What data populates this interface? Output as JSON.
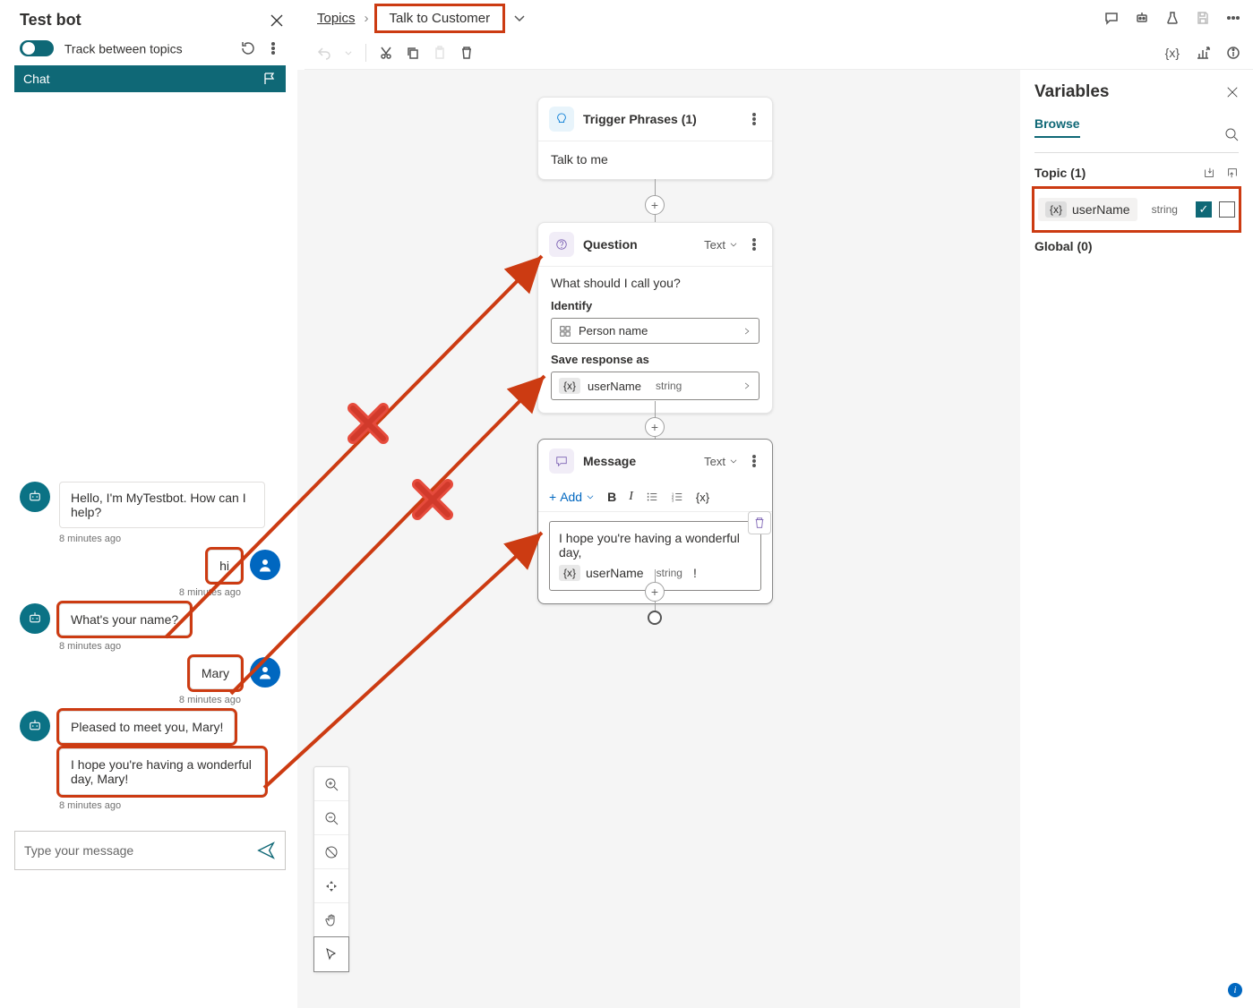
{
  "testPanel": {
    "title": "Test bot",
    "trackLabel": "Track between topics",
    "chatTab": "Chat",
    "inputPlaceholder": "Type your message",
    "messages": [
      {
        "role": "bot",
        "text": "Hello, I'm MyTestbot. How can I help?",
        "time": "8 minutes ago",
        "hl": false
      },
      {
        "role": "user",
        "text": "hi",
        "time": "8 minutes ago",
        "hl": true
      },
      {
        "role": "bot",
        "text": "What's your name?",
        "time": "8 minutes ago",
        "hl": true
      },
      {
        "role": "user",
        "text": "Mary",
        "time": "8 minutes ago",
        "hl": true
      },
      {
        "role": "bot",
        "text": "Pleased to meet you, Mary!",
        "time": "",
        "hl": true
      },
      {
        "role": "bot",
        "text": "I hope you're having a wonderful day, Mary!",
        "time": "8 minutes ago",
        "hl": true
      }
    ]
  },
  "breadcrumb": {
    "root": "Topics",
    "current": "Talk to Customer"
  },
  "canvas": {
    "trigger": {
      "title": "Trigger Phrases (1)",
      "phrase": "Talk to me"
    },
    "question": {
      "title": "Question",
      "type": "Text",
      "prompt": "What should I call you?",
      "identifyLabel": "Identify",
      "identifyValue": "Person name",
      "saveLabel": "Save response as",
      "varName": "userName",
      "varType": "string"
    },
    "message": {
      "title": "Message",
      "type": "Text",
      "addLabel": "Add",
      "text": "I hope you're having a wonderful day,",
      "varName": "userName",
      "varType": "string",
      "trail": "!"
    }
  },
  "variables": {
    "title": "Variables",
    "tab": "Browse",
    "topicLabel": "Topic (1)",
    "globalLabel": "Global (0)",
    "items": [
      {
        "name": "userName",
        "type": "string",
        "checked": true
      }
    ]
  }
}
